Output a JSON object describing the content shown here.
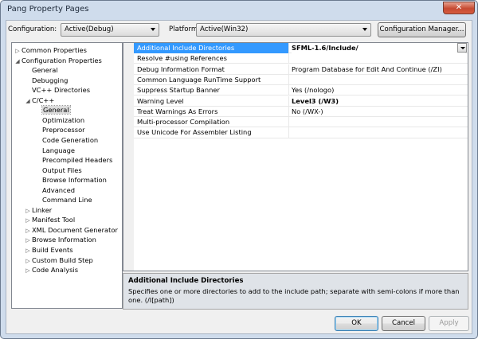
{
  "window": {
    "title": "Pang Property Pages",
    "close_glyph": "✕"
  },
  "toolbar": {
    "configuration_label": "Configuration:",
    "configuration_value": "Active(Debug)",
    "platform_label": "Platform:",
    "platform_value": "Active(Win32)",
    "config_manager_label": "Configuration Manager..."
  },
  "tree": {
    "items": [
      {
        "label": "Common Properties",
        "toggle": "▷"
      },
      {
        "label": "Configuration Properties",
        "toggle": "◢"
      },
      {
        "label": "General",
        "toggle": ""
      },
      {
        "label": "Debugging",
        "toggle": ""
      },
      {
        "label": "VC++ Directories",
        "toggle": ""
      },
      {
        "label": "C/C++",
        "toggle": "◢"
      },
      {
        "label": "General",
        "toggle": ""
      },
      {
        "label": "Optimization",
        "toggle": ""
      },
      {
        "label": "Preprocessor",
        "toggle": ""
      },
      {
        "label": "Code Generation",
        "toggle": ""
      },
      {
        "label": "Language",
        "toggle": ""
      },
      {
        "label": "Precompiled Headers",
        "toggle": ""
      },
      {
        "label": "Output Files",
        "toggle": ""
      },
      {
        "label": "Browse Information",
        "toggle": ""
      },
      {
        "label": "Advanced",
        "toggle": ""
      },
      {
        "label": "Command Line",
        "toggle": ""
      },
      {
        "label": "Linker",
        "toggle": "▷"
      },
      {
        "label": "Manifest Tool",
        "toggle": "▷"
      },
      {
        "label": "XML Document Generator",
        "toggle": "▷"
      },
      {
        "label": "Browse Information",
        "toggle": "▷"
      },
      {
        "label": "Build Events",
        "toggle": "▷"
      },
      {
        "label": "Custom Build Step",
        "toggle": "▷"
      },
      {
        "label": "Code Analysis",
        "toggle": "▷"
      }
    ]
  },
  "grid": {
    "rows": [
      {
        "name": "Additional Include Directories",
        "value": "SFML-1.6/Include/"
      },
      {
        "name": "Resolve #using References",
        "value": ""
      },
      {
        "name": "Debug Information Format",
        "value": "Program Database for Edit And Continue (/ZI)"
      },
      {
        "name": "Common Language RunTime Support",
        "value": ""
      },
      {
        "name": "Suppress Startup Banner",
        "value": "Yes (/nologo)"
      },
      {
        "name": "Warning Level",
        "value": "Level3 (/W3)"
      },
      {
        "name": "Treat Warnings As Errors",
        "value": "No (/WX-)"
      },
      {
        "name": "Multi-processor Compilation",
        "value": ""
      },
      {
        "name": "Use Unicode For Assembler Listing",
        "value": ""
      }
    ]
  },
  "description": {
    "title": "Additional Include Directories",
    "text": "Specifies one or more directories to add to the include path; separate with semi-colons if more than one. (/I[path])"
  },
  "buttons": {
    "ok": "OK",
    "cancel": "Cancel",
    "apply": "Apply"
  }
}
